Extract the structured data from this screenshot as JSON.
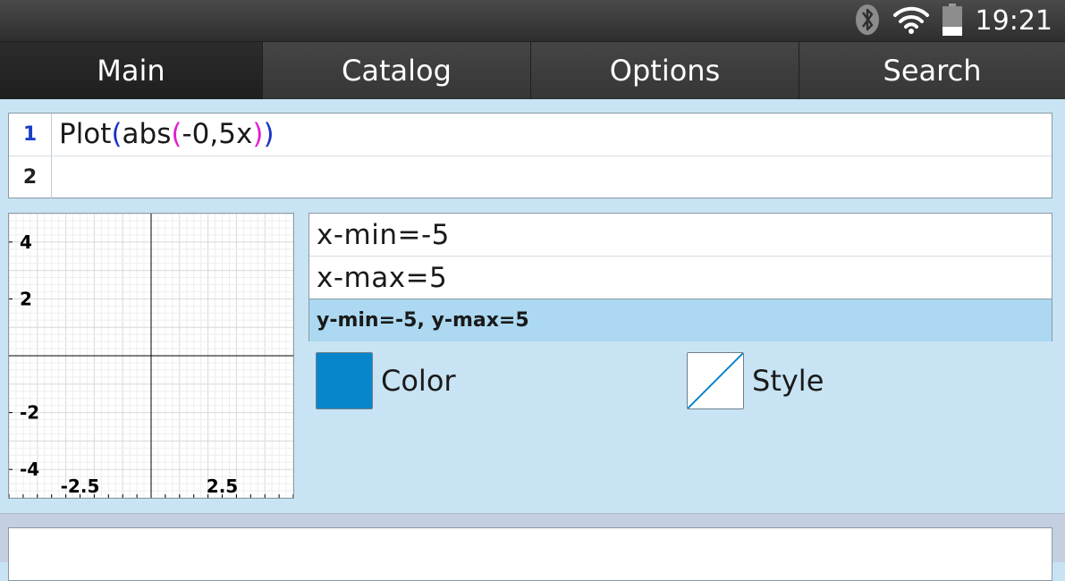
{
  "status": {
    "time": "19:21",
    "icons": [
      "bluetooth-icon",
      "wifi-icon",
      "battery-icon"
    ]
  },
  "tabs": [
    {
      "label": "Main",
      "active": true
    },
    {
      "label": "Catalog",
      "active": false
    },
    {
      "label": "Options",
      "active": false
    },
    {
      "label": "Search",
      "active": false
    }
  ],
  "input": {
    "lines": [
      {
        "number": "1",
        "fn": "Plot",
        "p1": "(",
        "inner_fn": "abs",
        "p2": "(",
        "arg": "-0,5x",
        "p3": ")",
        "p4": ")"
      },
      {
        "number": "2",
        "text": ""
      }
    ]
  },
  "graph": {
    "x_range": [
      -5,
      5
    ],
    "y_range": [
      -5,
      5
    ],
    "x_tick_labels": [
      "-2.5",
      "2.5"
    ],
    "y_tick_labels": [
      "4",
      "2",
      "-2",
      "-4"
    ],
    "grid": true
  },
  "settings": {
    "x_min": "x-min=-5",
    "x_max": "x-max=5",
    "y_range": "y-min=-5, y-max=5",
    "color_label": "Color",
    "style_label": "Style",
    "color_value": "#0886cc"
  }
}
